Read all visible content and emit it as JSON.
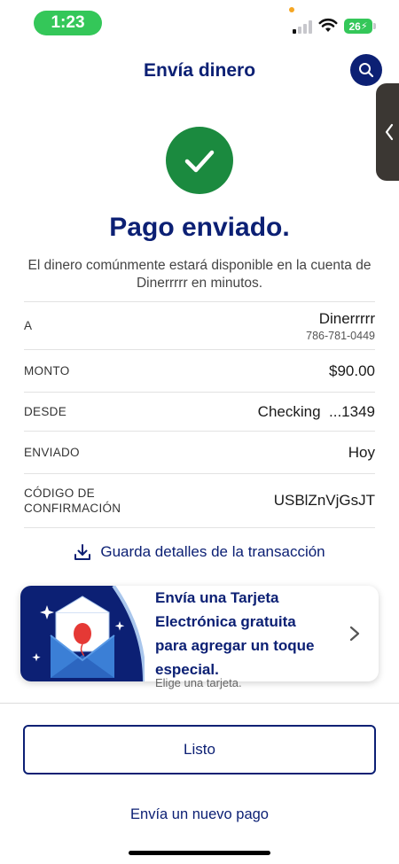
{
  "status_bar": {
    "time": "1:23",
    "battery": "26",
    "icons": [
      "cellular-signal-icon",
      "wifi-icon",
      "battery-charging-icon"
    ]
  },
  "header": {
    "title": "Envía dinero",
    "search_icon": "search-icon"
  },
  "side_tab_icon": "chevron-left-icon",
  "success": {
    "icon": "check-icon",
    "title": "Pago enviado.",
    "message": "El dinero comúnmente estará disponible en la cuenta de Dinerrrrr en minutos."
  },
  "details": {
    "to": {
      "label": "A",
      "name": "Dinerrrrr",
      "phone": "786-781-0449"
    },
    "amount": {
      "label": "MONTO",
      "value": "$90.00"
    },
    "from": {
      "label": "DESDE",
      "account": "Checking",
      "last4": "...1349"
    },
    "sent": {
      "label": "ENVIADO",
      "value": "Hoy"
    },
    "confirmation": {
      "label_line1": "CÓDIGO DE",
      "label_line2": "CONFIRMACIÓN",
      "value": "USBlZnVjGsJT"
    }
  },
  "save_details": {
    "label": "Guarda detalles de la transacción",
    "icon": "download-icon"
  },
  "ecard": {
    "line1": "Envía una Tarjeta",
    "line2": "Electrónica gratuita",
    "line3": "para agregar un toque",
    "line4": "especial.",
    "subtitle": "Elige una tarjeta.",
    "icon": "envelope-balloon-icon"
  },
  "actions": {
    "done": "Listo",
    "new_payment": "Envía un nuevo pago"
  },
  "colors": {
    "brand_navy": "#0c2074",
    "success_green": "#1b8a3f",
    "status_green": "#34c759"
  }
}
